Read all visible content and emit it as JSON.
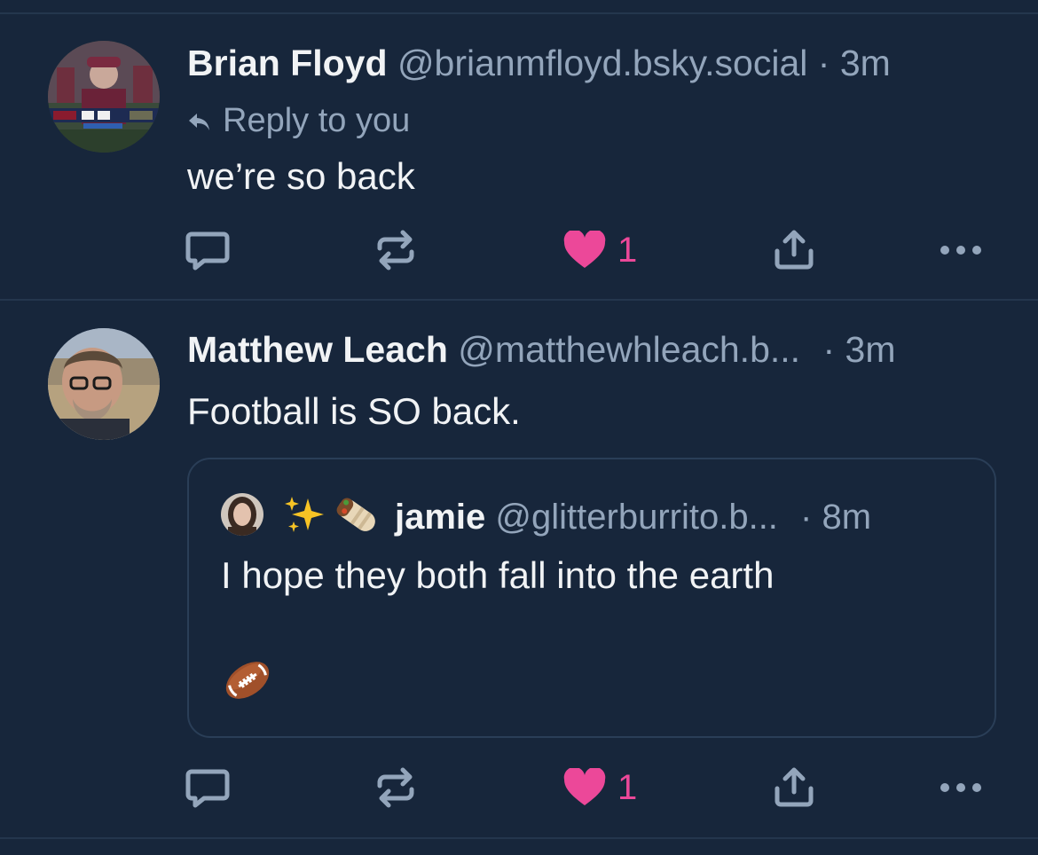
{
  "posts": [
    {
      "author_name": "Brian Floyd",
      "handle": "@brianmfloyd.bsky.social",
      "separator": "·",
      "time": "3m",
      "reply_label": "Reply to you",
      "text": "we’re so back",
      "like_count": "1"
    },
    {
      "author_name": "Matthew Leach",
      "handle": "@matthewhleach.b...",
      "separator": "·",
      "time": "3m",
      "text": "Football is SO back.",
      "like_count": "1",
      "quote": {
        "author_name": "jamie",
        "handle": "@glitterburrito.b...",
        "separator": "·",
        "time": "8m",
        "text": "I hope they both fall into the earth",
        "name_emoji": [
          "sparkles-icon",
          "burrito-icon"
        ],
        "attached_emoji": "football-icon"
      }
    }
  ],
  "icons": {
    "reply": "speech-bubble-icon",
    "repost": "repost-icon",
    "like": "heart-icon",
    "share": "share-icon",
    "more": "more-dots-icon"
  },
  "colors": {
    "background": "#17263b",
    "text": "#f1f3f5",
    "muted": "#93a5bb",
    "like": "#ec4899",
    "divider": "#24364d"
  }
}
